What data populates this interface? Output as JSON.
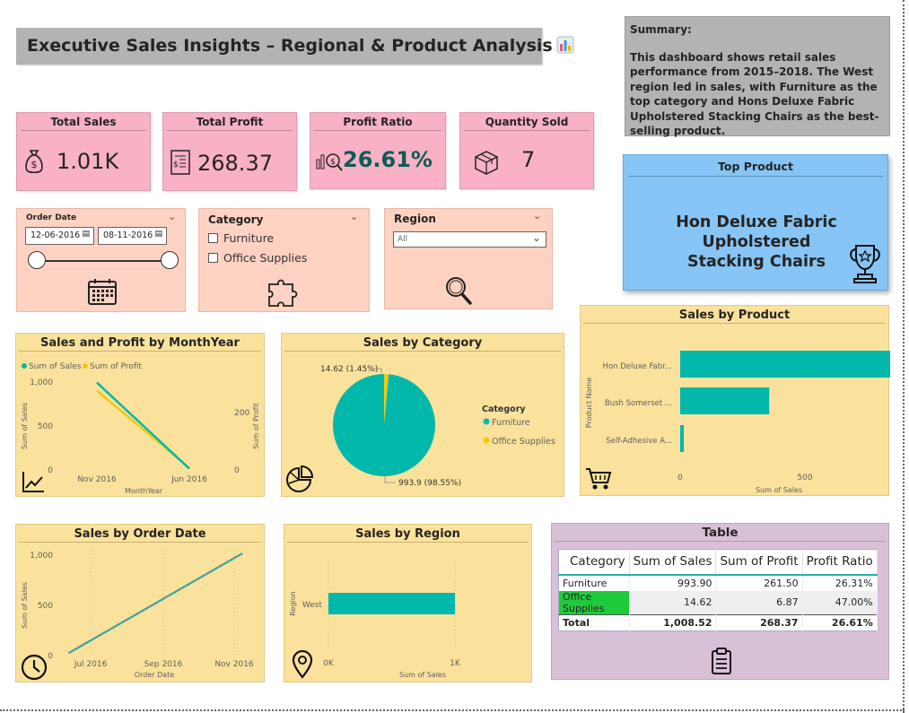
{
  "header": {
    "title": "Executive Sales Insights – Regional & Product Analysis",
    "title_icon": "bar-chart-emoji-icon"
  },
  "summary": {
    "title": "Summary:",
    "text": "This dashboard shows retail sales performance from 2015–2018. The West region led in sales, with Furniture as the top category and Hons Deluxe Fabric Upholstered Stacking Chairs as the best-selling product."
  },
  "kpis": [
    {
      "label": "Total Sales",
      "value": "1.01K",
      "icon": "money-bag-icon"
    },
    {
      "label": "Total Profit",
      "value": "268.37",
      "icon": "receipt-icon"
    },
    {
      "label": "Profit Ratio",
      "value": "26.61%",
      "icon": "profit-analysis-icon"
    },
    {
      "label": "Quantity Sold",
      "value": "7",
      "icon": "package-box-icon"
    }
  ],
  "order_date": {
    "label": "Order Date",
    "start": "12-06-2016",
    "end": "08-11-2016",
    "slider_min_fraction": 0,
    "slider_max_fraction": 1,
    "icon": "calendar-icon"
  },
  "category_slicer": {
    "label": "Category",
    "options": [
      "Furniture",
      "Office Supplies"
    ],
    "checked": [
      false,
      false
    ],
    "icon": "puzzle-icon"
  },
  "region_slicer": {
    "label": "Region",
    "selected": "All",
    "icon": "magnifier-icon"
  },
  "top_product": {
    "label": "Top Product",
    "line1": "Hon Deluxe Fabric Upholstered",
    "line2": "Stacking Chairs",
    "icon": "trophy-icon"
  },
  "colors": {
    "teal": "#01b8aa",
    "yellow": "#f2c80f",
    "pink": "#f9b1c5",
    "peach": "#fdd2c2",
    "sand": "#fae29c",
    "blue": "#86c5f6",
    "lilac": "#d8c0d6",
    "gray": "#b3b3b3",
    "highlight_green": "#1fcb3c"
  },
  "chart_data": [
    {
      "type": "line",
      "title": "Sales and Profit by MonthYear",
      "xlabel": "MonthYear",
      "ylabel": "Sum of Sales",
      "y2label": "Sum of Profit",
      "categories": [
        "Nov 2016",
        "Jun 2016"
      ],
      "series": [
        {
          "name": "Sum of Sales",
          "values": [
            993.9,
            14.62
          ],
          "color": "#01b8aa",
          "axis": "left"
        },
        {
          "name": "Sum of Profit",
          "values": [
            261.5,
            6.87
          ],
          "color": "#f2c80f",
          "axis": "right"
        }
      ],
      "y_ticks": [
        "1,000",
        "500",
        "0"
      ],
      "y2_ticks": [
        "200",
        "0"
      ],
      "ylim": [
        0,
        1000
      ],
      "y2lim": [
        0,
        290
      ],
      "legend": "top-left",
      "icon": "line-chart-icon"
    },
    {
      "type": "pie",
      "title": "Sales by Category",
      "legend_title": "Category",
      "labels": [
        "Furniture",
        "Office Supplies"
      ],
      "values": [
        993.9,
        14.62
      ],
      "data_labels": [
        "993.9 (98.55%)",
        "14.62 (1.45%)"
      ],
      "colors": [
        "#01b8aa",
        "#f2c80f"
      ],
      "legend": "right",
      "icon": "pie-chart-icon"
    },
    {
      "type": "bar",
      "orientation": "horizontal",
      "title": "Sales by Product",
      "ylabel": "Product Name",
      "xlabel": "Sum of Sales",
      "categories": [
        "Hon Deluxe Fabr...",
        "Bush Somerset ...",
        "Self-Adhesive A..."
      ],
      "values": [
        993.9,
        357,
        14.62
      ],
      "x_ticks": [
        "0",
        "500"
      ],
      "xlim": [
        0,
        1000
      ],
      "icon": "shopping-cart-icon"
    },
    {
      "type": "line",
      "title": "Sales by Order Date",
      "xlabel": "Order Date",
      "ylabel": "Sum of Sales",
      "x": [
        "2016-06-12",
        "2016-11-08"
      ],
      "values": [
        14.62,
        1008.52
      ],
      "x_ticks": [
        "Jul 2016",
        "Sep 2016",
        "Nov 2016"
      ],
      "y_ticks": [
        "1,000",
        "500",
        "0"
      ],
      "ylim": [
        0,
        1100
      ],
      "icon": "clock-icon"
    },
    {
      "type": "bar",
      "orientation": "horizontal",
      "title": "Sales by Region",
      "ylabel": "Region",
      "xlabel": "Sum of Sales",
      "categories": [
        "West"
      ],
      "values": [
        1008.52
      ],
      "x_ticks": [
        "0K",
        "1K"
      ],
      "xlim": [
        0,
        1000
      ],
      "icon": "location-pin-icon"
    },
    {
      "type": "table",
      "title": "Table",
      "columns": [
        "Category",
        "Sum of Sales",
        "Sum of Profit",
        "Profit Ratio"
      ],
      "rows": [
        [
          "Furniture",
          "993.90",
          "261.50",
          "26.31%"
        ],
        [
          "Office Supplies",
          "14.62",
          "6.87",
          "47.00%"
        ]
      ],
      "total": [
        "Total",
        "1,008.52",
        "268.37",
        "26.61%"
      ],
      "icon": "clipboard-icon"
    }
  ]
}
